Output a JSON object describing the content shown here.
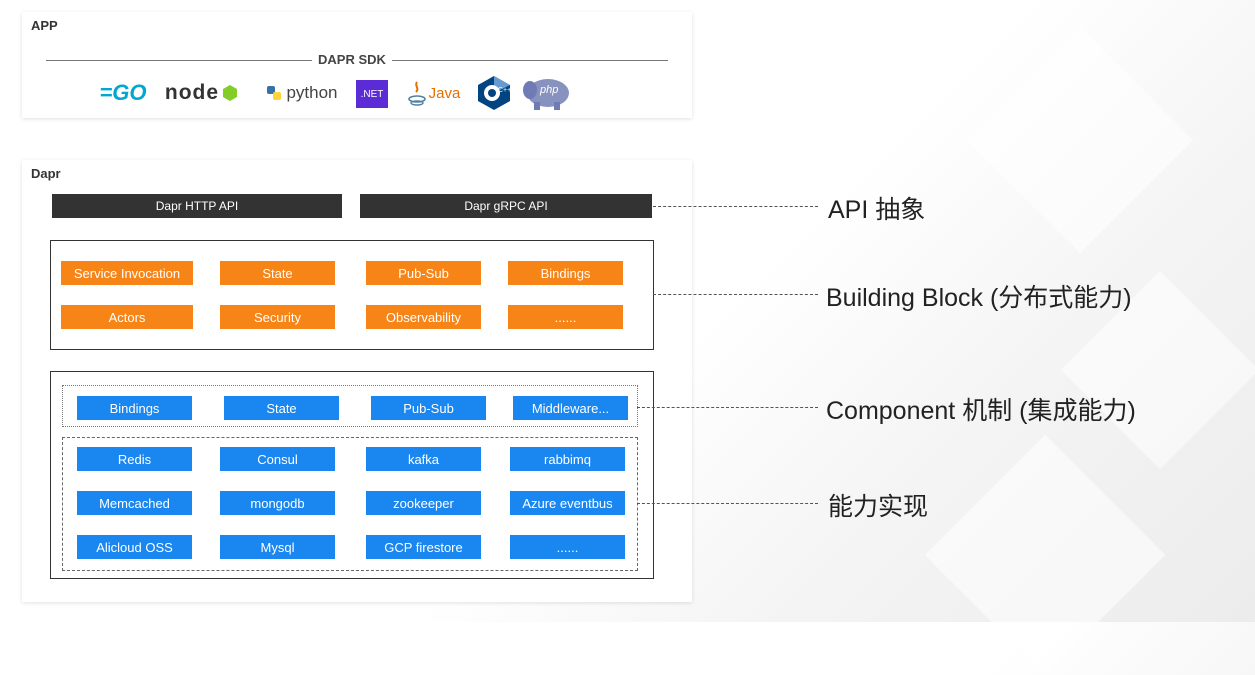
{
  "app": {
    "label": "APP",
    "sdk_title": "DAPR SDK",
    "logos": [
      {
        "icon": "go-logo-icon",
        "text": "=GO"
      },
      {
        "icon": "nodejs-logo-icon",
        "text": "node"
      },
      {
        "icon": "python-logo-icon",
        "text": "python"
      },
      {
        "icon": "dotnet-logo-icon",
        "text": ".NET"
      },
      {
        "icon": "java-logo-icon",
        "text": "Java"
      },
      {
        "icon": "cpp-logo-icon",
        "text": "C++"
      },
      {
        "icon": "php-logo-icon",
        "text": "php"
      }
    ]
  },
  "dapr": {
    "label": "Dapr",
    "apis": [
      "Dapr HTTP API",
      "Dapr gRPC API"
    ],
    "building_blocks": [
      [
        "Service Invocation",
        "State",
        "Pub-Sub",
        "Bindings"
      ],
      [
        "Actors",
        "Security",
        "Observability",
        "......"
      ]
    ],
    "components": [
      "Bindings",
      "State",
      "Pub-Sub",
      "Middleware..."
    ],
    "implementations": [
      [
        "Redis",
        "Consul",
        "kafka",
        "rabbimq"
      ],
      [
        "Memcached",
        "mongodb",
        "zookeeper",
        "Azure eventbus"
      ],
      [
        "Alicloud OSS",
        "Mysql",
        "GCP firestore",
        "......"
      ]
    ]
  },
  "annotations": {
    "api": "API 抽象",
    "building_block": "Building Block (分布式能力)",
    "component": "Component 机制 (集成能力)",
    "implementation": "能力实现"
  },
  "colors": {
    "api_bar": "#333333",
    "building_block": "#f78417",
    "component": "#1a86f0"
  }
}
